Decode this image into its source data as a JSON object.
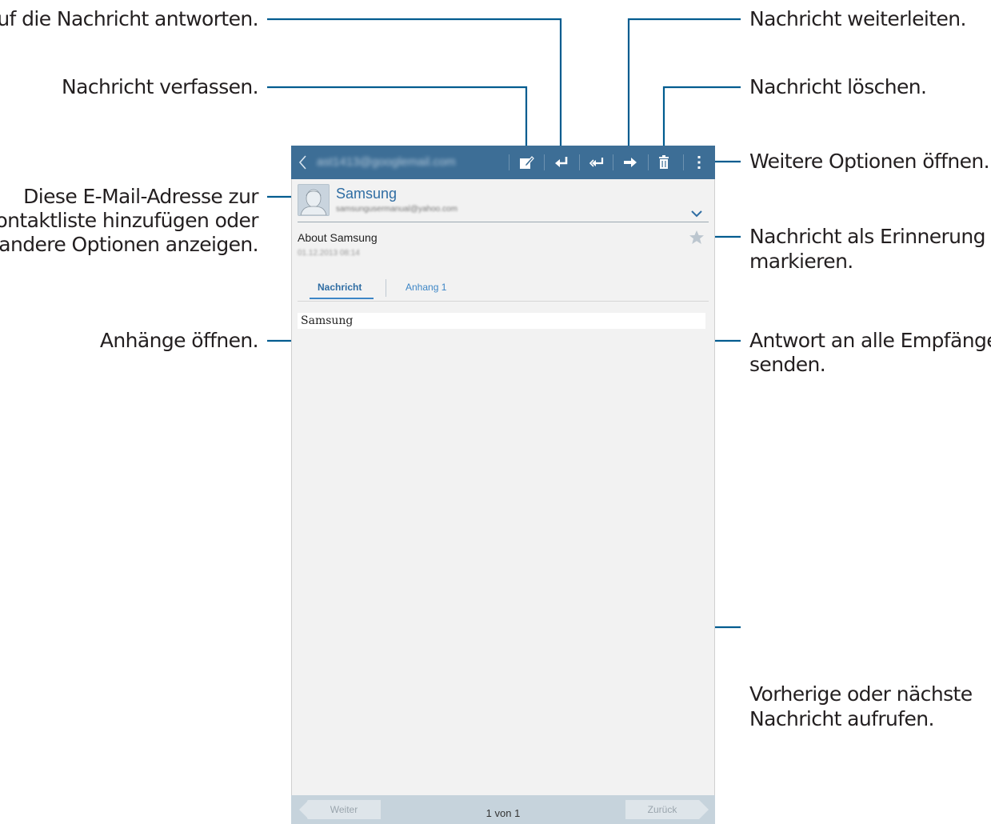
{
  "callouts": {
    "reply": "Auf die Nachricht antworten.",
    "compose": "Nachricht verfassen.",
    "forward": "Nachricht weiterleiten.",
    "delete": "Nachricht löschen.",
    "more_options": "Weitere Optionen öffnen.",
    "contact_line1": "Diese E-Mail-Adresse zur",
    "contact_line2": "Kontaktliste hinzufügen oder",
    "contact_line3": "andere Optionen anzeigen.",
    "reminder_line1": "Nachricht als Erinnerung",
    "reminder_line2": "markieren.",
    "attachments": "Anhänge öffnen.",
    "reply_all_line1": "Antwort an alle Empfänger",
    "reply_all_line2": "senden.",
    "nav_line1": "Vorherige oder nächste",
    "nav_line2": "Nachricht aufrufen."
  },
  "actionbar": {
    "account": "ast1413@googlemail.com",
    "icons": [
      "back-icon",
      "compose-icon",
      "reply-icon",
      "reply-all-icon",
      "forward-icon",
      "delete-icon",
      "more-options-icon"
    ]
  },
  "message": {
    "sender_name": "Samsung",
    "sender_email": "samsungusermanual@yahoo.com",
    "subject": "About Samsung",
    "date": "01.12.2013 08:14",
    "body": "Samsung"
  },
  "tabs": {
    "message": "Nachricht",
    "attachment": "Anhang 1"
  },
  "bottombar": {
    "prev": "Weiter",
    "pager": "1 von 1",
    "next": "Zurück"
  },
  "colors": {
    "actionbar": "#3d6e96",
    "accent": "#2f6da3",
    "callout_line": "#005c8f"
  }
}
